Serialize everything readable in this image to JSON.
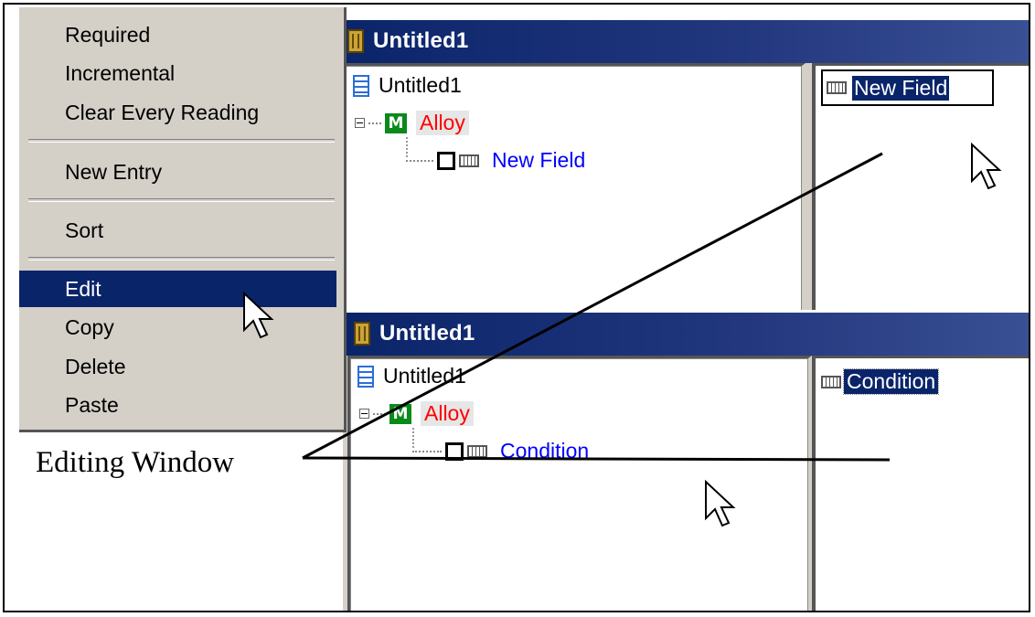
{
  "context_menu": {
    "items": [
      {
        "label": "Required"
      },
      {
        "label": "Incremental"
      },
      {
        "label": "Clear Every Reading"
      },
      {
        "label": "New Entry"
      },
      {
        "label": "Sort"
      },
      {
        "label": "Edit"
      },
      {
        "label": "Copy"
      },
      {
        "label": "Delete"
      },
      {
        "label": "Paste"
      }
    ],
    "active_item": "Edit"
  },
  "window_top": {
    "title": "Untitled1",
    "tree": {
      "root": "Untitled1",
      "material": "Alloy",
      "field": "New Field"
    },
    "edit_field": "New Field"
  },
  "window_bottom": {
    "title": "Untitled1",
    "tree": {
      "root": "Untitled1",
      "material": "Alloy",
      "field": "Condition"
    },
    "list_item": "Condition"
  },
  "annotation": {
    "caption": "Editing Window"
  },
  "icons": {
    "window": "database-icon",
    "root": "document-icon",
    "material": "m-icon",
    "field": "field-icon",
    "cursor": "arrow-cursor-icon"
  },
  "colors": {
    "titlebar": "#0a246a",
    "selection": "#0a246a",
    "material_text": "#ff0000",
    "field_text": "#0000ff",
    "material_icon": "#0a8a1a"
  }
}
